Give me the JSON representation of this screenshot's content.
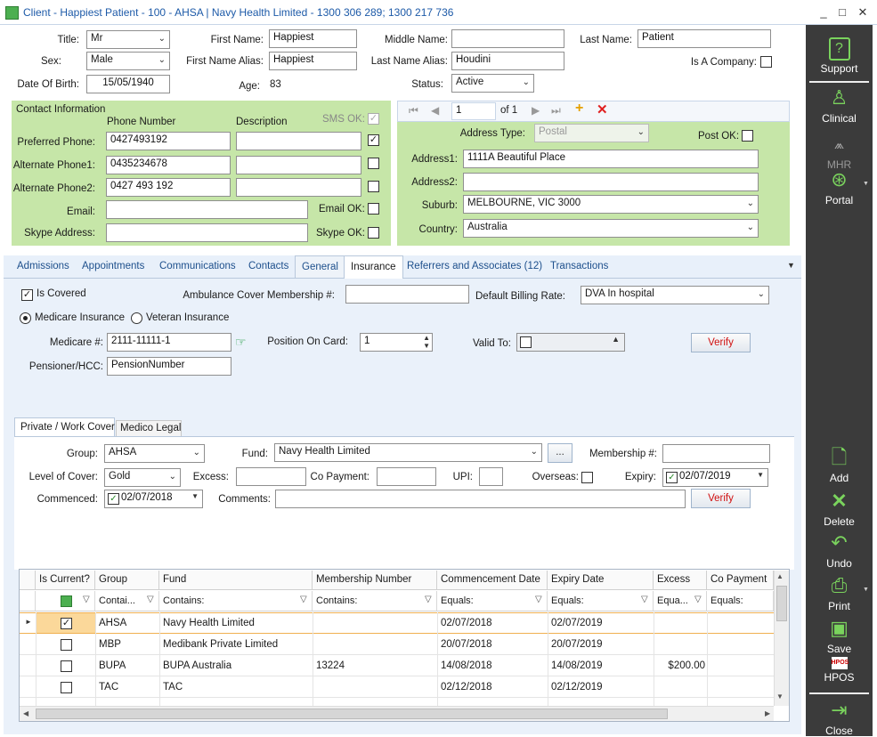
{
  "window": {
    "title": "Client - Happiest Patient - 100 - AHSA | Navy Health Limited - 1300 306 289; 1300 217 736",
    "minimize": "_",
    "maximize": "□",
    "close": "✕"
  },
  "demo": {
    "title_label": "Title:",
    "title_value": "Mr",
    "sex_label": "Sex:",
    "sex_value": "Male",
    "dob_label": "Date Of Birth:",
    "dob_value": "15/05/1940",
    "first_name_label": "First Name:",
    "first_name_value": "Happiest",
    "first_alias_label": "First Name Alias:",
    "first_alias_value": "Happiest",
    "age_label": "Age:",
    "age_value": "83",
    "middle_name_label": "Middle Name:",
    "middle_name_value": "",
    "last_alias_label": "Last Name Alias:",
    "last_alias_value": "Houdini",
    "status_label": "Status:",
    "status_value": "Active",
    "last_name_label": "Last Name:",
    "last_name_value": "Patient",
    "company_label": "Is A Company:"
  },
  "contact": {
    "heading": "Contact Information",
    "phone_header": "Phone Number",
    "desc_header": "Description",
    "sms_label": "SMS OK:",
    "preferred_label": "Preferred Phone:",
    "preferred_value": "0427493192",
    "alt1_label": "Alternate Phone1:",
    "alt1_value": "0435234678",
    "alt2_label": "Alternate Phone2:",
    "alt2_value": "0427 493 192",
    "email_label": "Email:",
    "email_ok_label": "Email OK:",
    "skype_label": "Skype Address:",
    "skype_ok_label": "Skype OK:"
  },
  "address": {
    "nav_page": "1",
    "nav_of": "of 1",
    "type_label": "Address  Type:",
    "type_value": "Postal",
    "post_ok_label": "Post OK:",
    "addr1_label": "Address1:",
    "addr1_value": "1111A Beautiful Place",
    "addr2_label": "Address2:",
    "addr2_value": "",
    "suburb_label": "Suburb:",
    "suburb_value": "MELBOURNE, VIC 3000",
    "country_label": "Country:",
    "country_value": "Australia"
  },
  "tabs": [
    "Admissions",
    "Appointments",
    "Communications",
    "Contacts",
    "General",
    "Insurance",
    "Referrers and Associates (12)",
    "Transactions"
  ],
  "insurance": {
    "is_covered_label": "Is Covered",
    "ambulance_label": "Ambulance Cover Membership #:",
    "billing_label": "Default Billing Rate:",
    "billing_value": "DVA In hospital",
    "medicare_radio": "Medicare Insurance",
    "veteran_radio": "Veteran Insurance",
    "medicare_label": "Medicare #:",
    "medicare_value": "2111-11111-1",
    "position_label": "Position On Card:",
    "position_value": "1",
    "valid_label": "Valid To:",
    "verify_label": "Verify",
    "pensioner_label": "Pensioner/HCC:",
    "pensioner_value": "PensionNumber"
  },
  "subtabs": [
    "Private / Work Cover",
    "Medico Legal"
  ],
  "private": {
    "group_label": "Group:",
    "group_value": "AHSA",
    "fund_label": "Fund:",
    "fund_value": "Navy Health Limited",
    "fund_btn": "...",
    "membership_label": "Membership #:",
    "level_label": "Level of Cover:",
    "level_value": "Gold",
    "excess_label": "Excess:",
    "copay_label": "Co Payment:",
    "upi_label": "UPI:",
    "overseas_label": "Overseas:",
    "expiry_label": "Expiry:",
    "expiry_value": "02/07/2019",
    "commenced_label": "Commenced:",
    "commenced_value": "02/07/2018",
    "comments_label": "Comments:",
    "verify_label": "Verify"
  },
  "grid": {
    "headers": [
      "Is Current?",
      "Group",
      "Fund",
      "Membership Number",
      "Commencement Date",
      "Expiry Date",
      "Excess",
      "Co Payment"
    ],
    "filters": [
      "",
      "Contai...",
      "Contains:",
      "Contains:",
      "Equals:",
      "Equals:",
      "Equa...",
      "Equals:"
    ],
    "rows": [
      {
        "current": true,
        "group": "AHSA",
        "fund": "Navy Health Limited",
        "member": "",
        "start": "02/07/2018",
        "expiry": "02/07/2019",
        "excess": "",
        "copay": ""
      },
      {
        "current": false,
        "group": "MBP",
        "fund": "Medibank Private Limited",
        "member": "",
        "start": "20/07/2018",
        "expiry": "20/07/2019",
        "excess": "",
        "copay": ""
      },
      {
        "current": false,
        "group": "BUPA",
        "fund": "BUPA Australia",
        "member": "13224",
        "start": "14/08/2018",
        "expiry": "14/08/2019",
        "excess": "$200.00",
        "copay": ""
      },
      {
        "current": false,
        "group": "TAC",
        "fund": "TAC",
        "member": "",
        "start": "02/12/2018",
        "expiry": "02/12/2019",
        "excess": "",
        "copay": ""
      }
    ]
  },
  "sidebar": {
    "support": "Support",
    "clinical": "Clinical",
    "mhr": "MHR",
    "portal": "Portal",
    "add": "Add",
    "delete": "Delete",
    "undo": "Undo",
    "print": "Print",
    "save": "Save",
    "hpos": "HPOS",
    "hpos_badge": "HPOS",
    "close": "Close"
  }
}
